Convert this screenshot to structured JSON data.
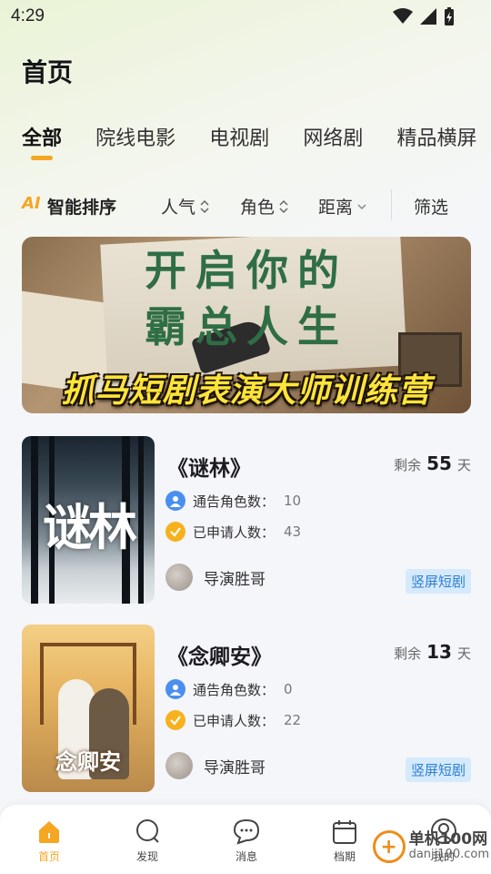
{
  "status": {
    "time": "4:29"
  },
  "header": {
    "title": "首页"
  },
  "tabs": [
    {
      "label": "全部"
    },
    {
      "label": "院线电影"
    },
    {
      "label": "电视剧"
    },
    {
      "label": "网络剧"
    },
    {
      "label": "精品横屏"
    }
  ],
  "sort": {
    "ai_badge": "AI",
    "ai_label": "智能排序",
    "items": [
      {
        "label": "人气"
      },
      {
        "label": "角色"
      },
      {
        "label": "距离"
      }
    ],
    "filter_label": "筛选"
  },
  "banner": {
    "title_line1": "开启你的",
    "title_line2": "霸总人生",
    "subtitle": "抓马短剧表演大师训练营"
  },
  "projects": [
    {
      "title": "《谜林》",
      "poster_text": "谜林",
      "remaining_label": "剩余",
      "remaining_days": "55",
      "days_unit": "天",
      "roles_label": "通告角色数：",
      "roles_count": "10",
      "applied_label": "已申请人数：",
      "applied_count": "43",
      "director": "导演胜哥",
      "tag": "竖屏短剧"
    },
    {
      "title": "《念卿安》",
      "poster_text": "念卿安",
      "remaining_label": "剩余",
      "remaining_days": "13",
      "days_unit": "天",
      "roles_label": "通告角色数：",
      "roles_count": "0",
      "applied_label": "已申请人数：",
      "applied_count": "22",
      "director": "导演胜哥",
      "tag": "竖屏短剧"
    }
  ],
  "tabbar": [
    {
      "label": "首页",
      "icon": "home-icon"
    },
    {
      "label": "发现",
      "icon": "search-icon"
    },
    {
      "label": "消息",
      "icon": "chat-icon"
    },
    {
      "label": "档期",
      "icon": "calendar-icon"
    },
    {
      "label": "我的",
      "icon": "profile-icon"
    }
  ],
  "watermark": {
    "brand": "单机100网",
    "url": "danji100.com"
  },
  "colors": {
    "accent": "#f5a623",
    "tag_bg": "#d5eafc",
    "tag_text": "#2f7fd4"
  }
}
